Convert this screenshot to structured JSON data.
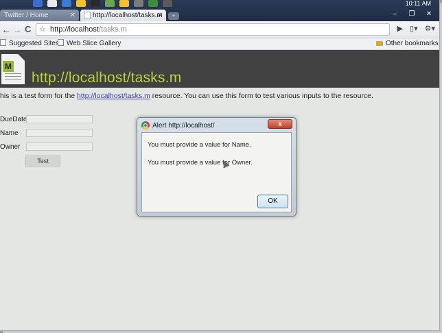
{
  "browser": {
    "tabs": [
      {
        "label": "Twitter / Home"
      },
      {
        "label": "http://localhost/tasks.m"
      }
    ],
    "clock": "10:11 AM",
    "window_controls": {
      "minimize": "–",
      "restore": "❐",
      "close": "✕"
    },
    "address": {
      "host": "http://localhost",
      "path": "/tasks.m"
    },
    "nav": {
      "back": "←",
      "forward": "→",
      "reload": "C",
      "star": "☆"
    },
    "toolbar_right": {
      "go": "▶",
      "page": "▯▾",
      "wrench": "⚙▾"
    },
    "bookmarks": {
      "items": [
        {
          "label": "Suggested Sites"
        },
        {
          "label": "Web Slice Gallery"
        }
      ],
      "other": "Other bookmarks"
    }
  },
  "page": {
    "header_logo_letter": "M",
    "header_title": "http://localhost/tasks.m",
    "intro_before": "his is a test form for the ",
    "intro_link": "http://localhost/tasks.m",
    "intro_after": " resource. You can use this form to test various inputs to the resource.",
    "fields": [
      {
        "label": "DueDate",
        "value": ""
      },
      {
        "label": "Name",
        "value": ""
      },
      {
        "label": "Owner",
        "value": ""
      }
    ],
    "test_button": "Test"
  },
  "alert": {
    "title": "Alert http://localhost/",
    "close_label": "x",
    "messages": [
      "You must provide a value for Name.",
      "You must provide a value for Owner."
    ],
    "ok_label": "OK"
  },
  "colors": {
    "header_bg": "#404140",
    "header_title": "#b7d336",
    "page_bg": "#e3e6e2",
    "link": "#3d3bb5"
  }
}
